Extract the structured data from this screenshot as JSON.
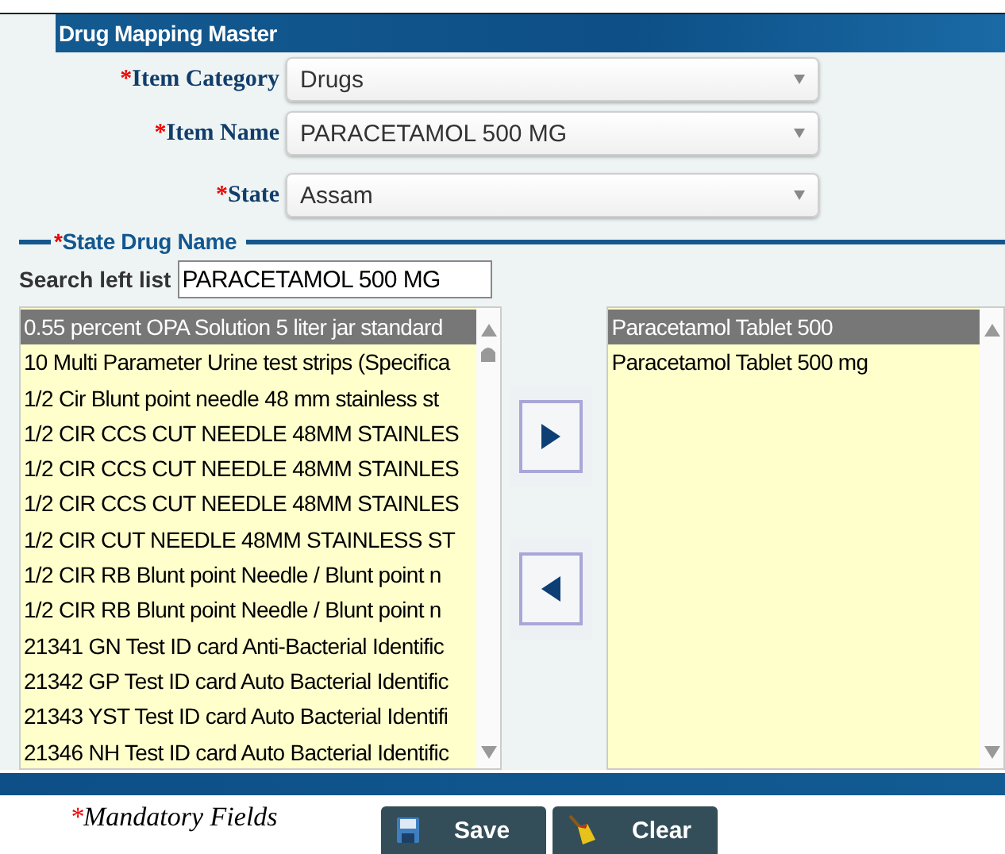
{
  "panel": {
    "title": "Drug Mapping Master"
  },
  "fields": [
    {
      "required_mark": "*",
      "label": "Item Category",
      "value": "Drugs"
    },
    {
      "required_mark": "*",
      "label": "Item Name",
      "value": "PARACETAMOL 500 MG"
    },
    {
      "required_mark": "*",
      "label": "State",
      "value": "Assam"
    }
  ],
  "section": {
    "required_mark": "*",
    "title": "State Drug Name"
  },
  "search": {
    "label": "Search left list",
    "value": "PARACETAMOL 500 MG"
  },
  "left_list": [
    {
      "text": "0.55 percent OPA Solution 5 liter jar standard",
      "selected": true
    },
    {
      "text": "10 Multi Parameter Urine test strips (Specifica",
      "selected": false
    },
    {
      "text": "1/2 Cir Blunt point needle 48 mm stainless st",
      "selected": false
    },
    {
      "text": "1/2 CIR CCS CUT NEEDLE 48MM STAINLES",
      "selected": false
    },
    {
      "text": "1/2 CIR CCS CUT NEEDLE 48MM STAINLES",
      "selected": false
    },
    {
      "text": "1/2 CIR CCS CUT NEEDLE 48MM STAINLES",
      "selected": false
    },
    {
      "text": "1/2 CIR CUT NEEDLE 48MM STAINLESS ST",
      "selected": false
    },
    {
      "text": "1/2 CIR RB Blunt point Needle / Blunt point n",
      "selected": false
    },
    {
      "text": "1/2 CIR RB Blunt point Needle / Blunt point n",
      "selected": false
    },
    {
      "text": "21341 GN Test ID card Anti-Bacterial Identific",
      "selected": false
    },
    {
      "text": "21342 GP Test ID card Auto Bacterial Identific",
      "selected": false
    },
    {
      "text": "21343 YST Test ID card Auto Bacterial Identifi",
      "selected": false
    },
    {
      "text": "21346 NH Test ID card Auto Bacterial Identific",
      "selected": false
    }
  ],
  "right_list": [
    {
      "text": "Paracetamol Tablet 500",
      "selected": true
    },
    {
      "text": "Paracetamol Tablet 500 mg",
      "selected": false
    }
  ],
  "footer": {
    "required_mark": "*",
    "note": "Mandatory Fields"
  },
  "buttons": [
    {
      "kind": "save",
      "label": "Save"
    },
    {
      "kind": "clear",
      "label": "Clear"
    }
  ]
}
